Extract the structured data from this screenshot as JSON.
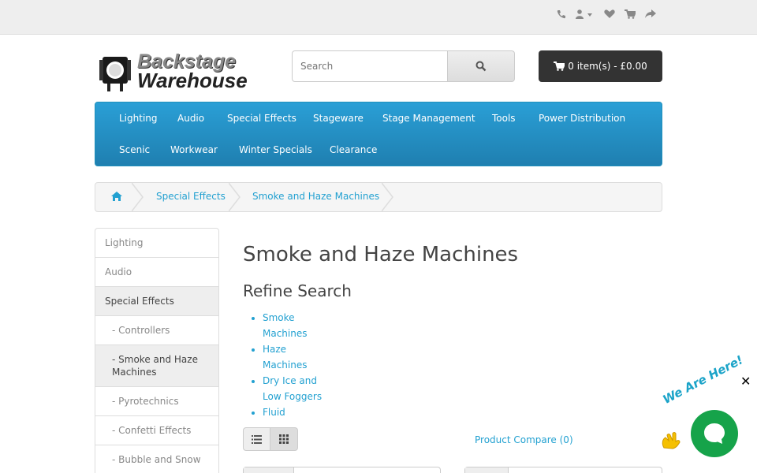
{
  "topbar": {
    "icons": [
      "phone-icon",
      "user-icon",
      "heart-icon",
      "cart-icon",
      "share-icon"
    ]
  },
  "logo": {
    "line1": "Backstage",
    "line2": "Warehouse"
  },
  "search": {
    "placeholder": "Search"
  },
  "cart": {
    "label": "0 item(s) - £0.00"
  },
  "nav": {
    "items": [
      "Lighting",
      "Audio",
      "Special Effects",
      "Stageware",
      "Stage Management",
      "Tools",
      "Power Distribution",
      "Scenic",
      "Workwear",
      "Winter Specials",
      "Clearance"
    ]
  },
  "breadcrumb": {
    "items": [
      "Special Effects",
      "Smoke and Haze Machines"
    ]
  },
  "sidebar": {
    "items": [
      "Lighting",
      "Audio",
      "Special Effects",
      "- Controllers",
      "- Smoke and Haze Machines",
      "- Pyrotechnics",
      "- Confetti Effects",
      "- Bubble and Snow"
    ]
  },
  "main": {
    "title": "Smoke and Haze Machines",
    "refine_title": "Refine Search",
    "refine_items": [
      "Smoke Machines",
      "Haze Machines",
      "Dry Ice and Low Foggers",
      "Fluid"
    ],
    "compare": "Product Compare (0)"
  },
  "chat": {
    "text": "We Are Here!",
    "close": "✕"
  },
  "colors": {
    "accent": "#23a1d1",
    "nav": "#2a9fd6",
    "chat": "#16a34a"
  }
}
